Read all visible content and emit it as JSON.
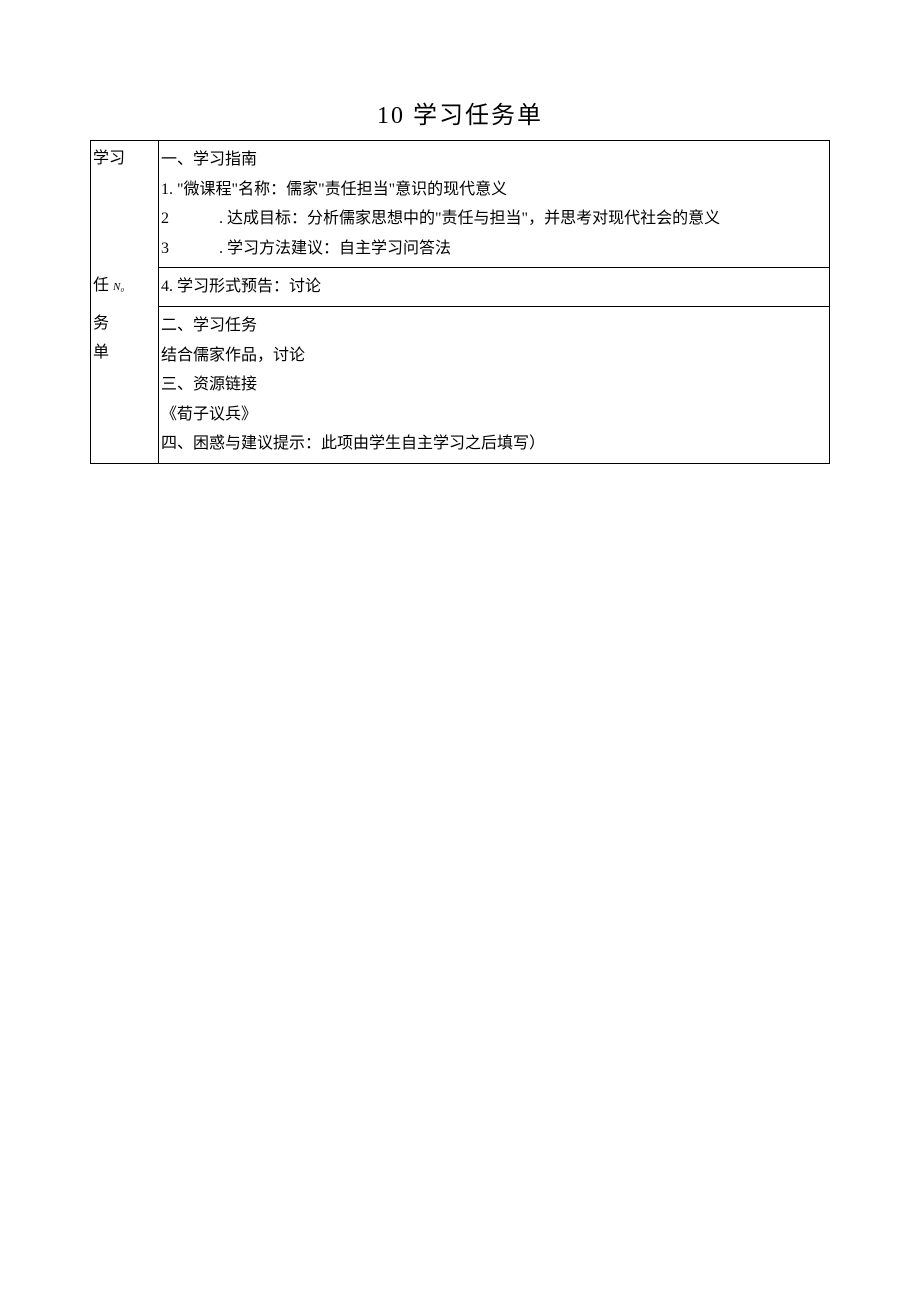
{
  "title": "10 学习任务单",
  "labels": {
    "col1_a": "学习",
    "col1_b": "任",
    "col1_b_sub": "N₀",
    "col1_c": "务",
    "col1_d": "单"
  },
  "section1": {
    "heading": "一、学习指南",
    "item1": "1. \"微课程\"名称：儒家\"责任担当\"意识的现代意义",
    "item2_num": "2",
    "item2_text": ". 达成目标：分析儒家思想中的\"责任与担当\"，并思考对现代社会的意义",
    "item3_num": "3",
    "item3_text": ". 学习方法建议：自主学习问答法"
  },
  "section1b": {
    "item4": "4. 学习形式预告：讨论"
  },
  "section2": {
    "heading": "二、学习任务",
    "item1": "结合儒家作品，讨论"
  },
  "section3": {
    "heading": "三、资源链接",
    "item1": "《荀子议兵》"
  },
  "section4": {
    "heading": "四、困惑与建议提示：此项由学生自主学习之后填写）"
  }
}
